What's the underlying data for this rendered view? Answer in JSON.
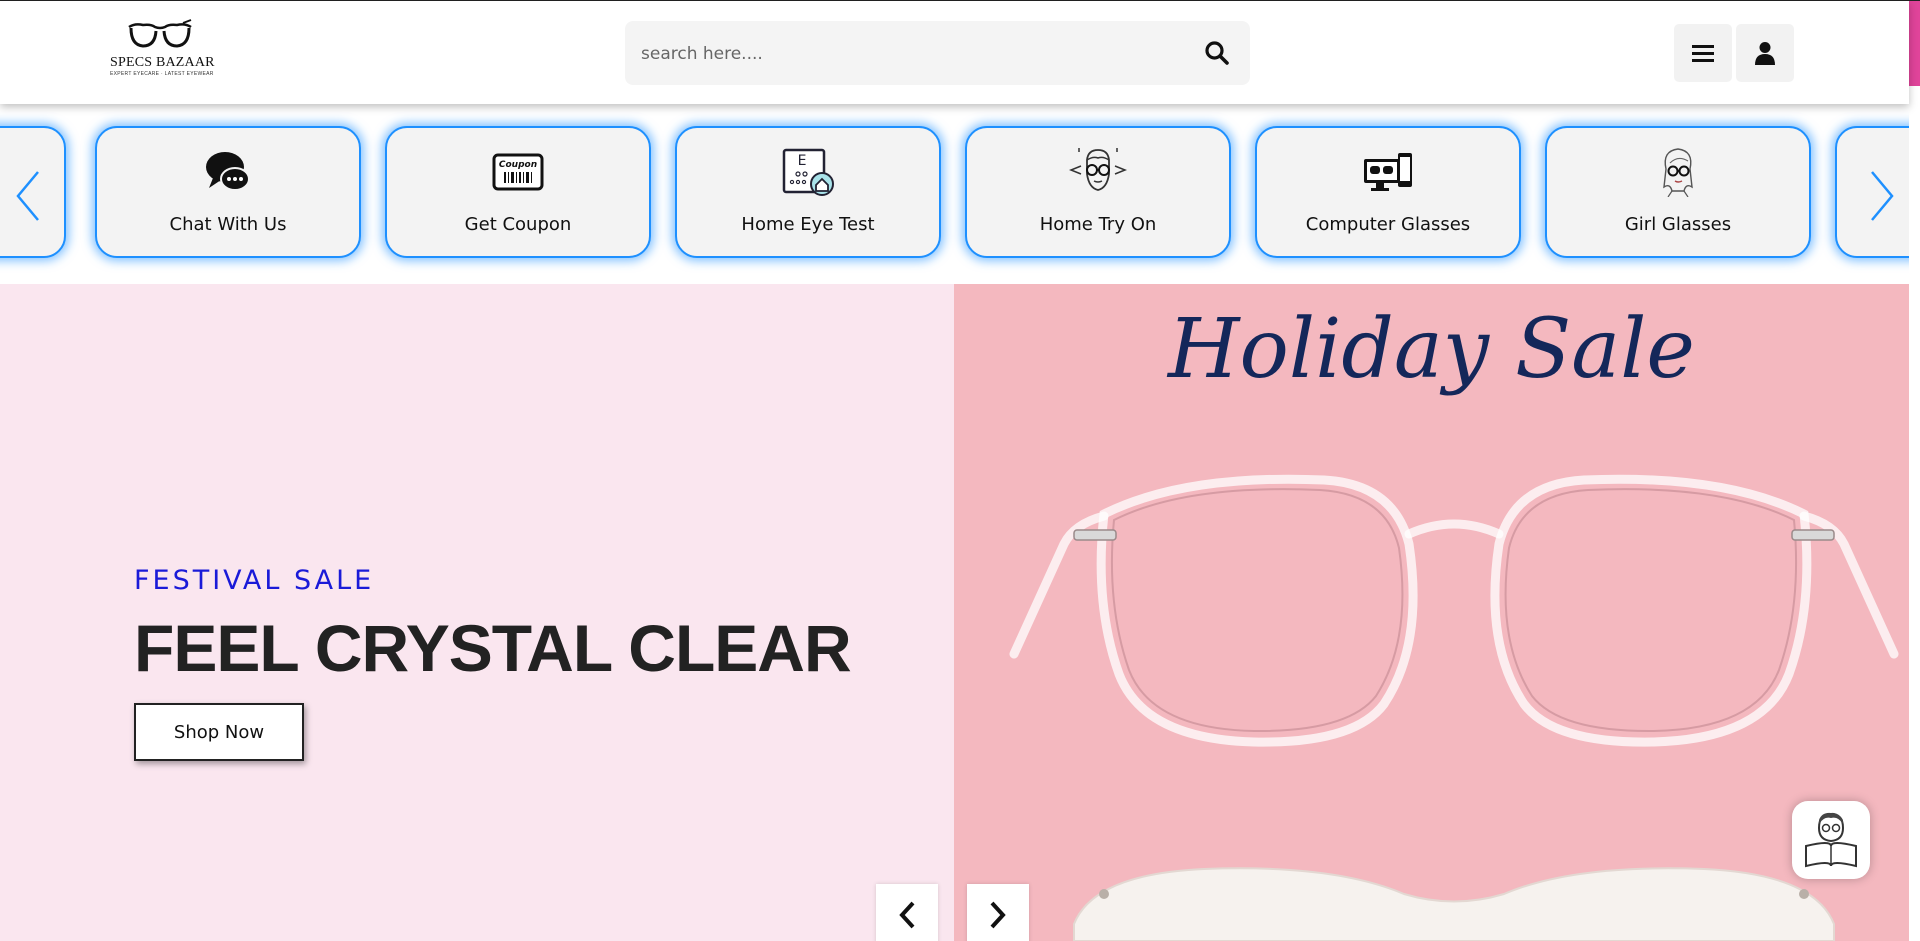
{
  "header": {
    "logo_text": "SPECS BAZAAR",
    "logo_tagline": "EXPERT EYECARE · LATEST EYEWEAR",
    "search_placeholder": "search here....",
    "icons": [
      "search-icon",
      "hamburger-menu-icon",
      "user-icon"
    ]
  },
  "quick_links": {
    "items": [
      {
        "label": "Chat With Us",
        "icon": "chat-bubble-icon"
      },
      {
        "label": "Get Coupon",
        "icon": "coupon-icon"
      },
      {
        "label": "Home Eye Test",
        "icon": "eye-chart-home-icon"
      },
      {
        "label": "Home Try On",
        "icon": "face-glasses-icon"
      },
      {
        "label": "Computer Glasses",
        "icon": "devices-icon"
      },
      {
        "label": "Girl Glasses",
        "icon": "girl-with-glasses-icon"
      }
    ],
    "arrow_color": "#1e90ff",
    "border_color": "#1e90ff"
  },
  "hero": {
    "kicker": "FESTIVAL SALE",
    "title": "FEEL CRYSTAL CLEAR",
    "cta_label": "Shop Now",
    "banner_text": "Holiday Sale",
    "left_bg": "#fae6ef",
    "right_bg": "#f4b8bf",
    "kicker_color": "#1a1ad8"
  },
  "colors": {
    "accent_pink": "#e0449a",
    "banner_text": "#14275a"
  }
}
